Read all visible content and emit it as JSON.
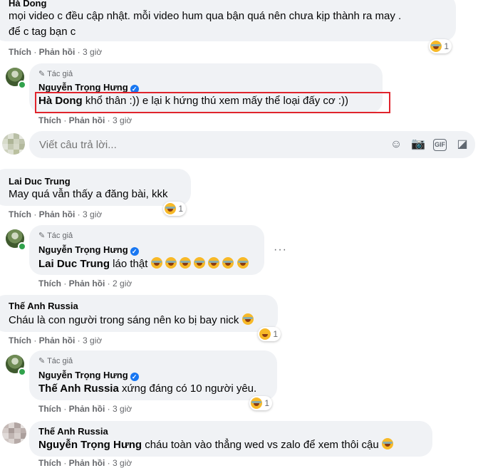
{
  "common": {
    "like": "Thích",
    "reply": "Phản hồi",
    "author_label": "Tác giả",
    "time_3h": "3 giờ",
    "time_2h": "2 giờ",
    "more": "···"
  },
  "c1": {
    "name": "Hà Dong",
    "line1": "mọi video c đều cập nhật. mỗi video hum qua bận quá nên chưa kịp thành ra may .",
    "line2": "để c tag bạn c",
    "reaction_count": "1"
  },
  "r1": {
    "name": "Nguyễn Trọng Hưng",
    "tag": "Hà Dong",
    "text": " khổ thân :)) e lại k hứng thú xem mấy thể loại đấy cơ :))"
  },
  "reply_box": {
    "placeholder": "Viết câu trả lời..."
  },
  "c2": {
    "name": "Lai Duc Trung",
    "text": "May quá vẫn thấy a đăng bài, kkk",
    "reaction_count": "1"
  },
  "r2": {
    "name": "Nguyễn Trọng Hưng",
    "tag": "Lai Duc Trung",
    "text": " láo thật"
  },
  "c3": {
    "name": "Thế Anh Russia",
    "text": "Cháu là con người trong sáng nên ko bị bay nick",
    "reaction_count": "1"
  },
  "r3": {
    "name": "Nguyễn Trọng Hưng",
    "tag": "Thế Anh Russia",
    "text": " xứng đáng có 10 người yêu.",
    "reaction_count": "1"
  },
  "c4": {
    "name": "Thế Anh Russia",
    "tag": "Nguyễn Trọng Hưng",
    "text": " cháu toàn vào thẳng wed vs zalo để xem thôi cậu"
  },
  "colors": {
    "highlight": "#e0242c",
    "verified": "#1877f2",
    "online": "#31a24c"
  }
}
